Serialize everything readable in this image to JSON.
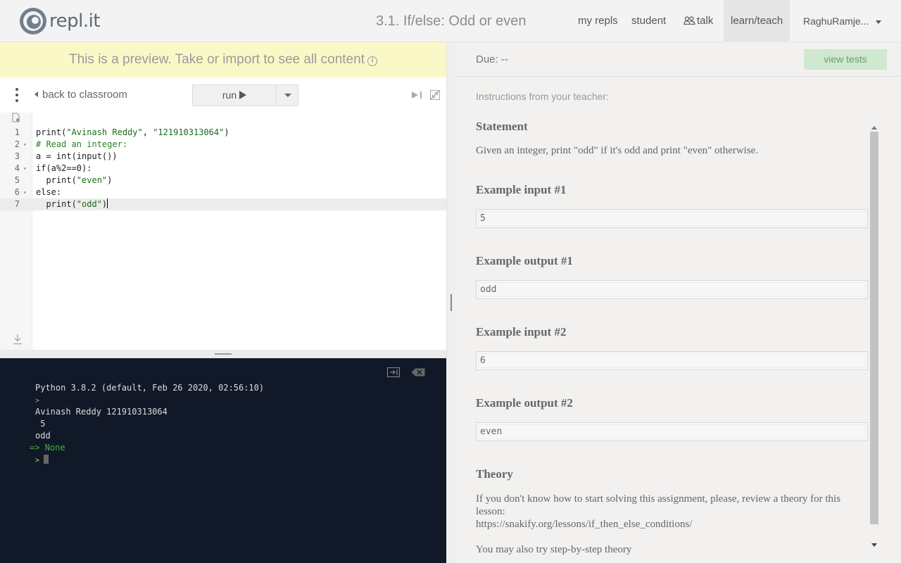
{
  "header": {
    "logo_text": "repl.it",
    "title": "3.1. If/else: Odd or even",
    "nav": [
      "my repls",
      "student",
      "talk",
      "learn/teach"
    ],
    "user": "RaghuRamje..."
  },
  "banner": {
    "text": "This is a preview. Take or import to see all content"
  },
  "toolbar": {
    "back_label": "back to classroom",
    "run_label": "run"
  },
  "editor": {
    "lines": [
      {
        "n": "1",
        "fold": "",
        "text": "print(\"Avinash Reddy\", \"121910313064\")"
      },
      {
        "n": "2",
        "fold": "▾",
        "text": "# Read an integer:"
      },
      {
        "n": "3",
        "fold": "",
        "text": "a = int(input())"
      },
      {
        "n": "4",
        "fold": "▾",
        "text": "if(a%2==0):"
      },
      {
        "n": "5",
        "fold": "",
        "text": "  print(\"even\")"
      },
      {
        "n": "6",
        "fold": "▾",
        "text": "else:"
      },
      {
        "n": "7",
        "fold": "",
        "text": "  print(\"odd\")"
      }
    ],
    "current_line": 7
  },
  "console": {
    "lines": [
      "Python 3.8.2 (default, Feb 26 2020, 02:56:10)",
      ">",
      "Avinash Reddy 121910313064",
      " 5",
      "odd",
      "=> None",
      ">"
    ]
  },
  "instructions": {
    "due": "Due: --",
    "view_tests": "view tests",
    "label": "Instructions from your teacher:",
    "statement_title": "Statement",
    "statement_text": "Given an integer, print \"odd\" if it's odd and print \"even\" otherwise.",
    "examples": [
      {
        "title": "Example input #1",
        "value": "5"
      },
      {
        "title": "Example output #1",
        "value": "odd"
      },
      {
        "title": "Example input #2",
        "value": "6"
      },
      {
        "title": "Example output #2",
        "value": "even"
      }
    ],
    "theory_title": "Theory",
    "theory_text_1": "If you don't know how to start solving this assignment, please, review a theory for this lesson:",
    "theory_link": "https://snakify.org/lessons/if_then_else_conditions/",
    "theory_text_2": "You may also try step-by-step theory"
  },
  "colors": {
    "banner_bg": "#fbf8c8",
    "console_bg": "#111828",
    "view_tests_bg": "#cfe8cf",
    "accent_green": "#3fb33f"
  }
}
